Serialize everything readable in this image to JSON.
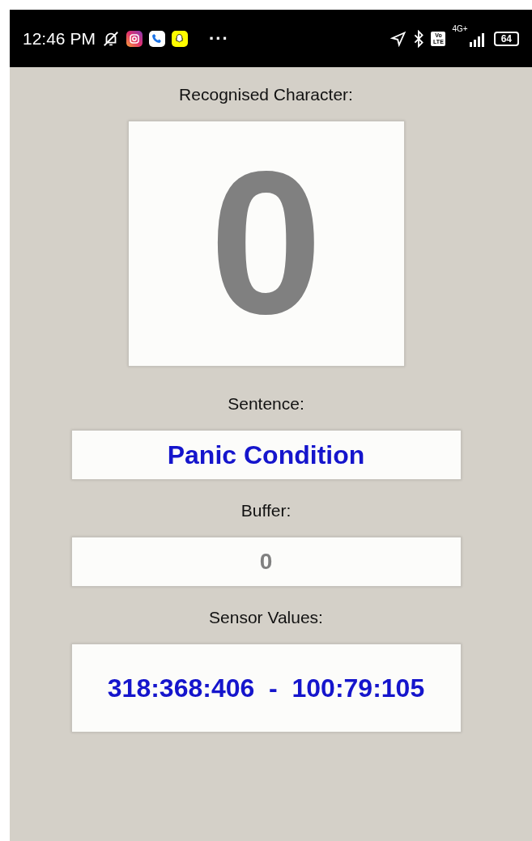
{
  "status_bar": {
    "time": "12:46 PM",
    "more": "···",
    "volte": "Vo LTE",
    "network": "4G+",
    "battery": "64"
  },
  "recognised": {
    "label": "Recognised Character:",
    "value": "0"
  },
  "sentence": {
    "label": "Sentence:",
    "value": "Panic Condition"
  },
  "buffer": {
    "label": "Buffer:",
    "value": "0"
  },
  "sensor": {
    "label": "Sensor Values:",
    "value": "318:368:406  -  100:79:105"
  }
}
